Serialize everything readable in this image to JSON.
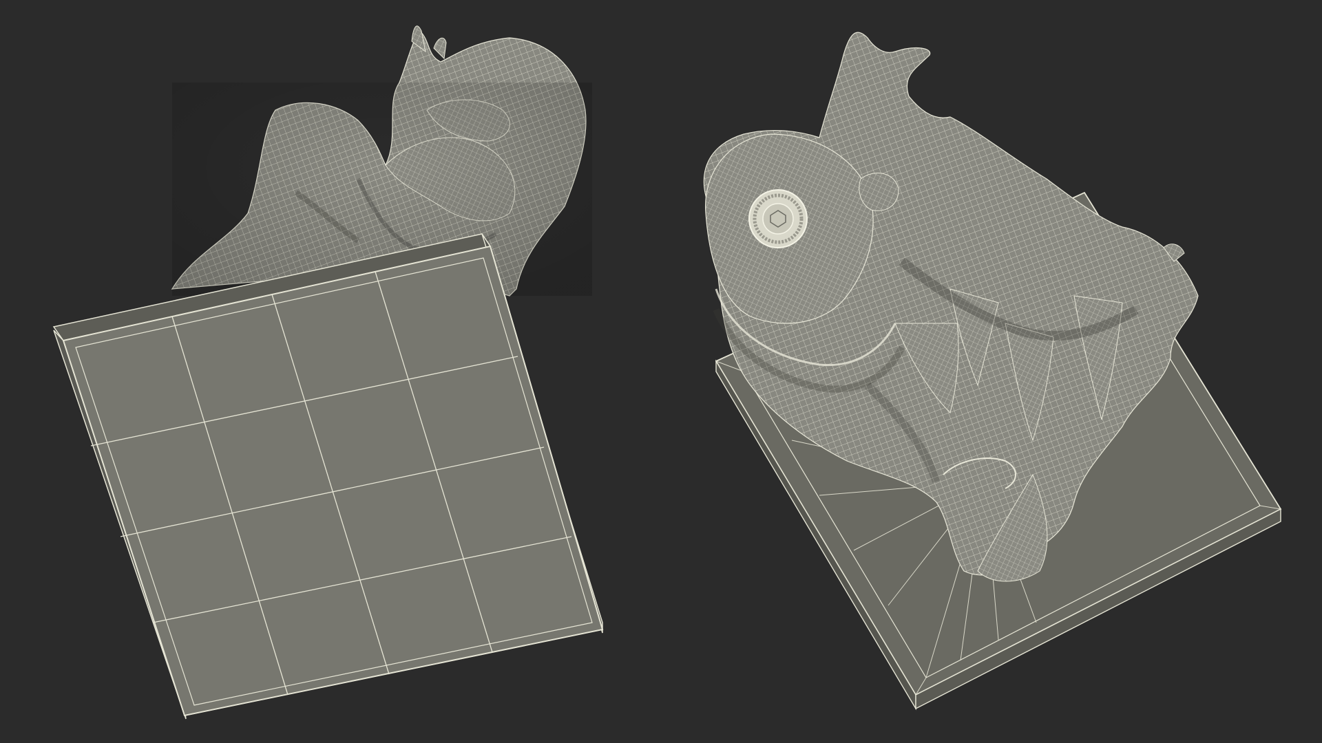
{
  "scene": {
    "background_color": "#2b2b2b",
    "model_color": "#7f7f77",
    "wire_color": "#f1f0e2",
    "base_color": "#6d6d65",
    "views": [
      {
        "name": "bottom-view",
        "subject": "wireframe-sculpture-on-square-base"
      },
      {
        "name": "top-view",
        "subject": "wireframe-sculpture-on-square-base"
      }
    ]
  }
}
